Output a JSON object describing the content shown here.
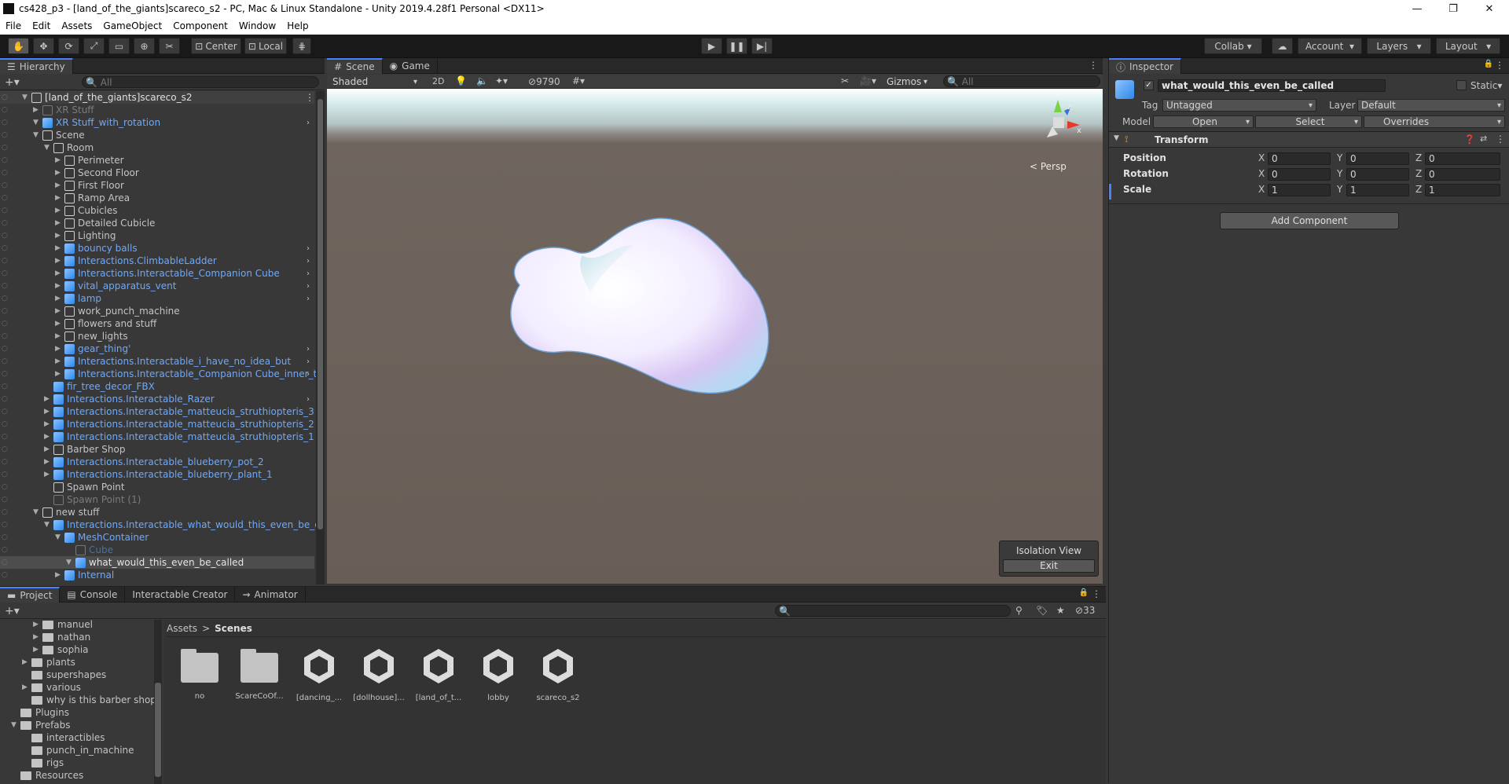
{
  "window": {
    "title": "cs428_p3 - [land_of_the_giants]scareco_s2 - PC, Mac & Linux Standalone - Unity 2019.4.28f1 Personal <DX11>"
  },
  "menu": [
    "File",
    "Edit",
    "Assets",
    "GameObject",
    "Component",
    "Window",
    "Help"
  ],
  "toolbar": {
    "center": "Center",
    "local": "Local",
    "collab": "Collab",
    "account": "Account",
    "layers": "Layers",
    "layout": "Layout"
  },
  "hierarchy": {
    "tab": "Hierarchy",
    "search_placeholder": "All",
    "rows": [
      {
        "label": "[land_of_the_giants]scareco_s2",
        "style": "scene",
        "indent": 0
      },
      {
        "label": "XR Stuff",
        "style": "dim",
        "indent": 1
      },
      {
        "label": "XR Stuff_with_rotation",
        "style": "blue",
        "indent": 1
      },
      {
        "label": "Scene",
        "style": "gray",
        "indent": 1
      },
      {
        "label": "Room",
        "style": "gray",
        "indent": 2
      },
      {
        "label": "Perimeter",
        "style": "gray",
        "indent": 3
      },
      {
        "label": "Second Floor",
        "style": "gray",
        "indent": 3
      },
      {
        "label": "First Floor",
        "style": "gray",
        "indent": 3
      },
      {
        "label": "Ramp Area",
        "style": "gray",
        "indent": 3
      },
      {
        "label": "Cubicles",
        "style": "gray",
        "indent": 3
      },
      {
        "label": "Detailed Cubicle",
        "style": "gray",
        "indent": 3
      },
      {
        "label": "Lighting",
        "style": "gray",
        "indent": 3
      },
      {
        "label": "bouncy balls",
        "style": "blue",
        "indent": 3
      },
      {
        "label": "Interactions.ClimbableLadder",
        "style": "blue",
        "indent": 3
      },
      {
        "label": "Interactions.Interactable_Companion Cube",
        "style": "blue",
        "indent": 3
      },
      {
        "label": "vital_apparatus_vent",
        "style": "blue",
        "indent": 3
      },
      {
        "label": "lamp",
        "style": "blue",
        "indent": 3
      },
      {
        "label": "work_punch_machine",
        "style": "gray",
        "indent": 3
      },
      {
        "label": "flowers and stuff",
        "style": "gray",
        "indent": 3
      },
      {
        "label": "new_lights",
        "style": "gray",
        "indent": 3
      },
      {
        "label": "gear_thing'",
        "style": "blue",
        "indent": 3
      },
      {
        "label": "Interactions.Interactable_i_have_no_idea_but",
        "style": "blue",
        "indent": 3
      },
      {
        "label": "Interactions.Interactable_Companion Cube_inner_t",
        "style": "blue",
        "indent": 3
      },
      {
        "label": "fir_tree_decor_FBX",
        "style": "blue",
        "indent": 2
      },
      {
        "label": "Interactions.Interactable_Razer",
        "style": "blue",
        "indent": 2
      },
      {
        "label": "Interactions.Interactable_matteucia_struthiopteris_3",
        "style": "blue",
        "indent": 2
      },
      {
        "label": "Interactions.Interactable_matteucia_struthiopteris_2",
        "style": "blue",
        "indent": 2
      },
      {
        "label": "Interactions.Interactable_matteucia_struthiopteris_1",
        "style": "blue",
        "indent": 2
      },
      {
        "label": "Barber Shop",
        "style": "gray",
        "indent": 2
      },
      {
        "label": "Interactions.Interactable_blueberry_pot_2",
        "style": "blue",
        "indent": 2
      },
      {
        "label": "Interactions.Interactable_blueberry_plant_1",
        "style": "blue",
        "indent": 2
      },
      {
        "label": "Spawn Point",
        "style": "gray",
        "indent": 2
      },
      {
        "label": "Spawn Point (1)",
        "style": "dim",
        "indent": 2
      },
      {
        "label": "new stuff",
        "style": "gray",
        "indent": 1
      },
      {
        "label": "Interactions.Interactable_what_would_this_even_be_call",
        "style": "blue",
        "indent": 2
      },
      {
        "label": "MeshContainer",
        "style": "blue",
        "indent": 3
      },
      {
        "label": "Cube",
        "style": "dimblue",
        "indent": 4
      },
      {
        "label": "what_would_this_even_be_called",
        "style": "selected",
        "indent": 4
      },
      {
        "label": "Internal",
        "style": "blue",
        "indent": 3
      }
    ]
  },
  "scene": {
    "tabs": [
      "Scene",
      "Game"
    ],
    "shading": "Shaded",
    "mode2d": "2D",
    "hidden_count": "9790",
    "gizmos": "Gizmos",
    "search_placeholder": "All",
    "persp": "< Persp",
    "isolation_title": "Isolation View",
    "isolation_exit": "Exit",
    "axis_x": "x",
    "axis_z": "z"
  },
  "inspector": {
    "tab": "Inspector",
    "object_name": "what_would_this_even_be_called",
    "static_label": "Static",
    "tag_label": "Tag",
    "tag_value": "Untagged",
    "layer_label": "Layer",
    "layer_value": "Default",
    "model_label": "Model",
    "open": "Open",
    "select": "Select",
    "overrides": "Overrides",
    "transform": "Transform",
    "position": {
      "label": "Position",
      "x": "0",
      "y": "0",
      "z": "0"
    },
    "rotation": {
      "label": "Rotation",
      "x": "0",
      "y": "0",
      "z": "0"
    },
    "scale": {
      "label": "Scale",
      "x": "1",
      "y": "1",
      "z": "1"
    },
    "add_component": "Add Component",
    "axis": {
      "x": "X",
      "y": "Y",
      "z": "Z"
    }
  },
  "bottom": {
    "tabs": [
      "Project",
      "Console",
      "Interactable Creator",
      "Animator"
    ],
    "hidden_count": "33",
    "breadcrumb": [
      "Assets",
      "Scenes"
    ],
    "tree": [
      {
        "label": "manuel",
        "indent": 3
      },
      {
        "label": "nathan",
        "indent": 3
      },
      {
        "label": "sophia",
        "indent": 3
      },
      {
        "label": "plants",
        "indent": 2
      },
      {
        "label": "supershapes",
        "indent": 2
      },
      {
        "label": "various",
        "indent": 2
      },
      {
        "label": "why is this barber shop",
        "indent": 2
      },
      {
        "label": "Plugins",
        "indent": 1
      },
      {
        "label": "Prefabs",
        "indent": 1
      },
      {
        "label": "interactibles",
        "indent": 2
      },
      {
        "label": "punch_in_machine",
        "indent": 2
      },
      {
        "label": "rigs",
        "indent": 2
      },
      {
        "label": "Resources",
        "indent": 1
      }
    ],
    "items": [
      {
        "label": "no",
        "kind": "folder"
      },
      {
        "label": "ScareCoOf...",
        "kind": "folder"
      },
      {
        "label": "[dancing_...",
        "kind": "scene"
      },
      {
        "label": "[dollhouse]...",
        "kind": "scene"
      },
      {
        "label": "[land_of_t...",
        "kind": "scene"
      },
      {
        "label": "lobby",
        "kind": "scene"
      },
      {
        "label": "scareco_s2",
        "kind": "scene"
      }
    ]
  }
}
